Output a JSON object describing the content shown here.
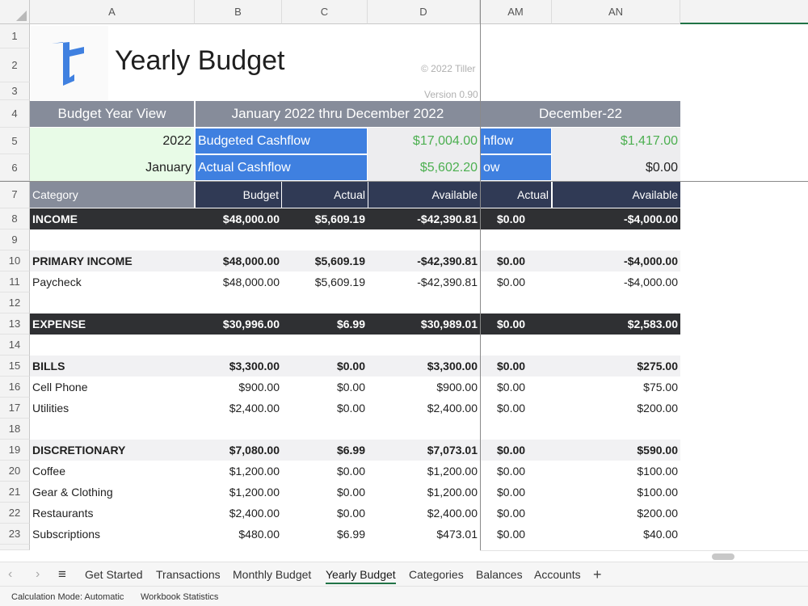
{
  "columns": {
    "A": "A",
    "B": "B",
    "C": "C",
    "D": "D",
    "AM": "AM",
    "AN": "AN"
  },
  "rows": [
    "1",
    "2",
    "3",
    "4",
    "5",
    "6",
    "7",
    "8",
    "9",
    "10",
    "11",
    "12",
    "13",
    "14",
    "15",
    "16",
    "17",
    "18",
    "19",
    "20",
    "21",
    "22",
    "23"
  ],
  "header": {
    "title": "Yearly Budget",
    "copyright": "© 2022 Tiller",
    "version": "Version 0.90"
  },
  "row4": {
    "view": "Budget Year View",
    "range": "January 2022 thru December 2022",
    "month": "December-22"
  },
  "row5": {
    "year": "2022",
    "label": "Budgeted Cashflow",
    "value": "$17,004.00",
    "right_label": "hflow",
    "right_value": "$1,417.00"
  },
  "row6": {
    "month": "January",
    "label": "Actual Cashflow",
    "value": "$5,602.20",
    "right_label": "ow",
    "right_value": "$0.00"
  },
  "row7": {
    "category": "Category",
    "budget": "Budget",
    "actual": "Actual",
    "available": "Available",
    "am": "Actual",
    "an": "Available"
  },
  "data_rows": {
    "r8": {
      "a": "INCOME",
      "b": "$48,000.00",
      "c": "$5,609.19",
      "d": "-$42,390.81",
      "am": "$0.00",
      "an": "-$4,000.00"
    },
    "r10": {
      "a": "PRIMARY INCOME",
      "b": "$48,000.00",
      "c": "$5,609.19",
      "d": "-$42,390.81",
      "am": "$0.00",
      "an": "-$4,000.00"
    },
    "r11": {
      "a": "Paycheck",
      "b": "$48,000.00",
      "c": "$5,609.19",
      "d": "-$42,390.81",
      "am": "$0.00",
      "an": "-$4,000.00"
    },
    "r13": {
      "a": "EXPENSE",
      "b": "$30,996.00",
      "c": "$6.99",
      "d": "$30,989.01",
      "am": "$0.00",
      "an": "$2,583.00"
    },
    "r15": {
      "a": "BILLS",
      "b": "$3,300.00",
      "c": "$0.00",
      "d": "$3,300.00",
      "am": "$0.00",
      "an": "$275.00"
    },
    "r16": {
      "a": "Cell Phone",
      "b": "$900.00",
      "c": "$0.00",
      "d": "$900.00",
      "am": "$0.00",
      "an": "$75.00"
    },
    "r17": {
      "a": "Utilities",
      "b": "$2,400.00",
      "c": "$0.00",
      "d": "$2,400.00",
      "am": "$0.00",
      "an": "$200.00"
    },
    "r19": {
      "a": "DISCRETIONARY",
      "b": "$7,080.00",
      "c": "$6.99",
      "d": "$7,073.01",
      "am": "$0.00",
      "an": "$590.00"
    },
    "r20": {
      "a": "Coffee",
      "b": "$1,200.00",
      "c": "$0.00",
      "d": "$1,200.00",
      "am": "$0.00",
      "an": "$100.00"
    },
    "r21": {
      "a": "Gear & Clothing",
      "b": "$1,200.00",
      "c": "$0.00",
      "d": "$1,200.00",
      "am": "$0.00",
      "an": "$100.00"
    },
    "r22": {
      "a": "Restaurants",
      "b": "$2,400.00",
      "c": "$0.00",
      "d": "$2,400.00",
      "am": "$0.00",
      "an": "$200.00"
    },
    "r23": {
      "a": "Subscriptions",
      "b": "$480.00",
      "c": "$6.99",
      "d": "$473.01",
      "am": "$0.00",
      "an": "$40.00"
    }
  },
  "tabs": [
    "Get Started",
    "Transactions",
    "Monthly Budget",
    "Yearly Budget",
    "Categories",
    "Balances",
    "Accounts"
  ],
  "active_tab": "Yearly Budget",
  "status": {
    "calc_mode": "Calculation Mode: Automatic",
    "stats": "Workbook Statistics"
  },
  "icons": {
    "prev": "chevron-left-icon",
    "next": "chevron-right-icon",
    "menu": "hamburger-menu-icon",
    "add": "plus-icon",
    "logo": "tiller-logo"
  },
  "colors": {
    "accent_blue": "#3f80e0",
    "header_gray": "#868c9a",
    "navy": "#303a55",
    "dark_row": "#2f3033",
    "green_text": "#4caf50",
    "excel_green": "#217346"
  }
}
